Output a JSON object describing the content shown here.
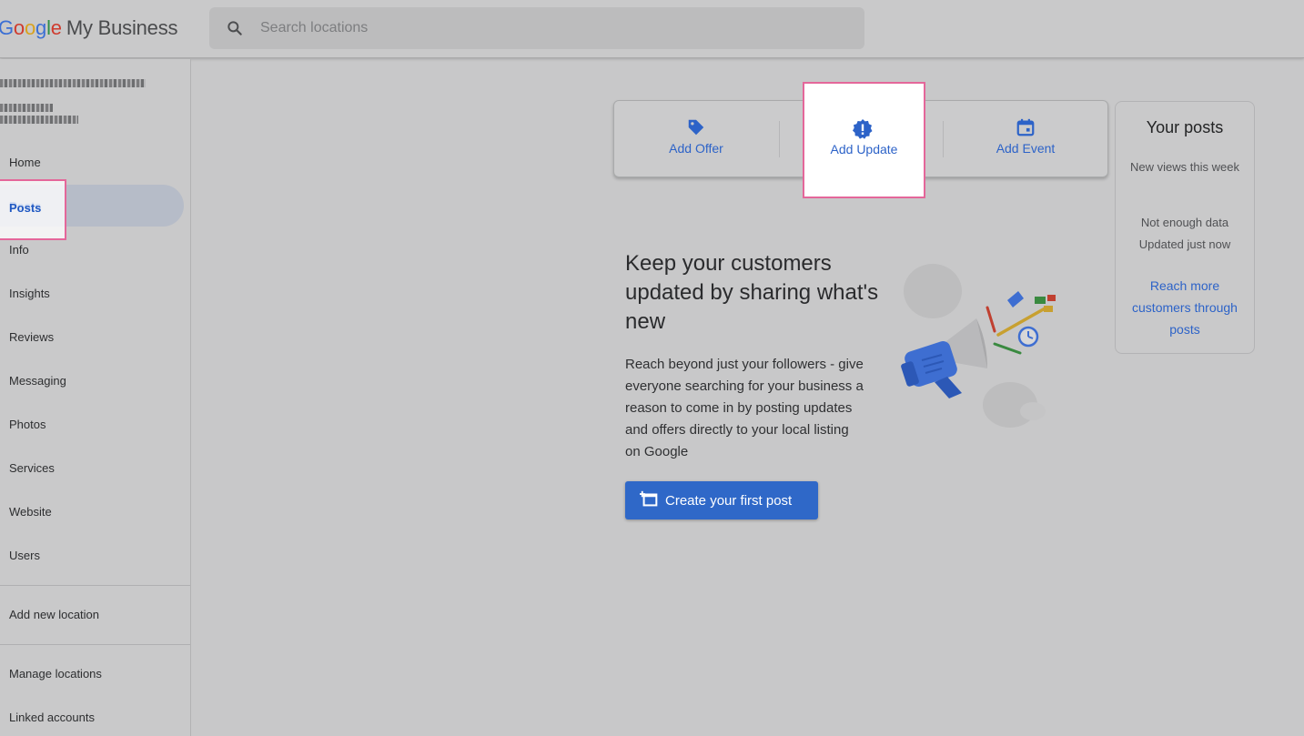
{
  "header": {
    "logo_letters": [
      "G",
      "o",
      "o",
      "g",
      "l",
      "e"
    ],
    "logo_suffix": "My Business",
    "search_placeholder": "Search locations",
    "search_icon": "search-icon"
  },
  "sidebar": {
    "items": [
      {
        "label": "Home"
      },
      {
        "label": "Posts"
      },
      {
        "label": "Info"
      },
      {
        "label": "Insights"
      },
      {
        "label": "Reviews"
      },
      {
        "label": "Messaging"
      },
      {
        "label": "Photos"
      },
      {
        "label": "Services"
      },
      {
        "label": "Website"
      },
      {
        "label": "Users"
      }
    ],
    "add_location": "Add new location",
    "manage_locations": "Manage locations",
    "linked_accounts": "Linked accounts"
  },
  "post_types": {
    "offer": {
      "label": "Add Offer",
      "icon": "tag-icon"
    },
    "update": {
      "label": "Add Update",
      "icon": "update-badge-icon"
    },
    "event": {
      "label": "Add Event",
      "icon": "calendar-icon"
    }
  },
  "side_card": {
    "title": "Your posts",
    "views_label": "New views this week",
    "status": "Not enough data",
    "updated": "Updated just now",
    "link": "Reach more customers through posts"
  },
  "main": {
    "headline": "Keep your customers updated by sharing what's new",
    "body": "Reach beyond just your followers - give everyone searching for your business a reason to come in by posting updates and offers directly to your local listing on Google",
    "cta_label": "Create your first post",
    "cta_icon": "add-post-icon",
    "illustration": "megaphone-illustration"
  },
  "colors": {
    "accent": "#2f68c8",
    "highlight": "#e4679a",
    "background": "#c8c8c9"
  }
}
